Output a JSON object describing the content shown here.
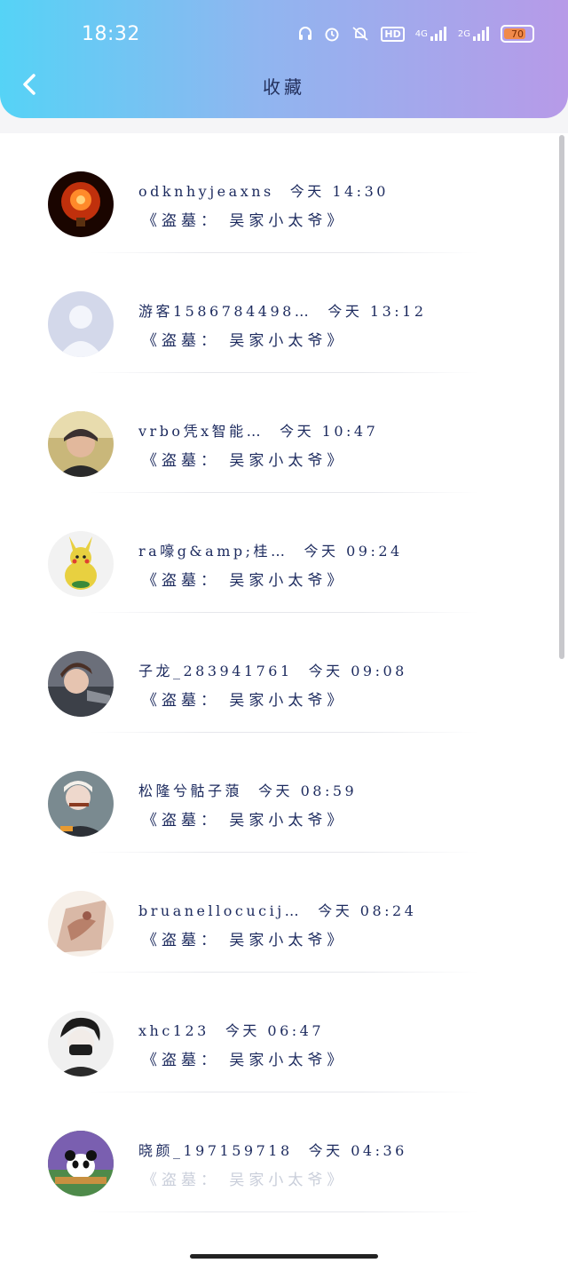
{
  "status": {
    "time": "18:32",
    "battery": "70",
    "net1": "4G",
    "net2": "2G",
    "hd": "HD"
  },
  "header": {
    "title": "收藏"
  },
  "items": [
    {
      "name": "odknhyjeaxns",
      "date": "今天 14:30",
      "subtitle": "《盗墓： 吴家小太爷》",
      "avatar_icon": "bulb-avatar",
      "avatar_color": "#c0300c",
      "faded": false
    },
    {
      "name": "游客1586784498…",
      "date": "今天 13:12",
      "subtitle": "《盗墓： 吴家小太爷》",
      "avatar_icon": "default-user-avatar",
      "avatar_color": "#d3d8ea",
      "faded": false
    },
    {
      "name": "vrbo凭x智能…",
      "date": "今天 10:47",
      "subtitle": "《盗墓： 吴家小太爷》",
      "avatar_icon": "person-avatar",
      "avatar_color": "#c9b77a",
      "faded": false
    },
    {
      "name": "ra嚎g&amp;桂…",
      "date": "今天 09:24",
      "subtitle": "《盗墓： 吴家小太爷》",
      "avatar_icon": "pikachu-avatar",
      "avatar_color": "#e8d040",
      "faded": false
    },
    {
      "name": "子龙_283941761",
      "date": "今天 09:08",
      "subtitle": "《盗墓： 吴家小太爷》",
      "avatar_icon": "anime-boy-avatar",
      "avatar_color": "#6b6f7a",
      "faded": false
    },
    {
      "name": "松隆兮骷子蒗",
      "date": "今天 08:59",
      "subtitle": "《盗墓： 吴家小太爷》",
      "avatar_icon": "selfie-avatar",
      "avatar_color": "#7a8a90",
      "faded": false
    },
    {
      "name": "bruanellocucij…",
      "date": "今天 08:24",
      "subtitle": "《盗墓： 吴家小太爷》",
      "avatar_icon": "painting-avatar",
      "avatar_color": "#d9b8a6",
      "faded": false
    },
    {
      "name": "xhc123",
      "date": "今天 06:47",
      "subtitle": "《盗墓： 吴家小太爷》",
      "avatar_icon": "mask-boy-avatar",
      "avatar_color": "#f0f0f0",
      "faded": false
    },
    {
      "name": "晓颜_197159718",
      "date": "今天 04:36",
      "subtitle": "《盗墓： 吴家小太爷》",
      "avatar_icon": "panda-avatar",
      "avatar_color": "#7a5fb0",
      "faded": true
    }
  ]
}
